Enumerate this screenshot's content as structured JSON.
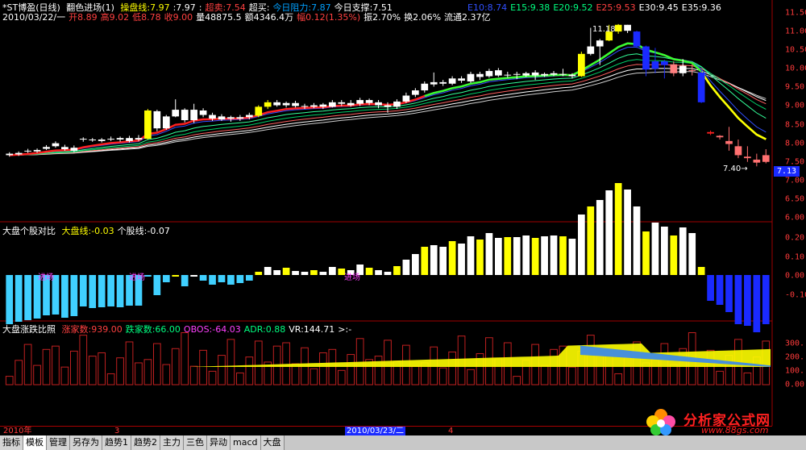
{
  "top_panel": {
    "title": "*ST博盈(日线)",
    "indicator": "翻色进场(1)",
    "items": [
      {
        "label": "操盘线:7.97",
        "color": "#ffff00"
      },
      {
        "label": ":7.97",
        "color": "#ffffff"
      },
      {
        "label": ":",
        "color": "#ffffff"
      },
      {
        "label": "超卖:7.54",
        "color": "#ff4040"
      },
      {
        "label": "超买:",
        "color": "#ffffff"
      },
      {
        "label": "今日阻力:7.87",
        "color": "#00a0ff"
      },
      {
        "label": "今日支撑:7.51",
        "color": "#ffffff"
      }
    ],
    "ma": [
      {
        "label": "E10:8.74",
        "color": "#3050ff"
      },
      {
        "label": "E15:9.38",
        "color": "#00ff80"
      },
      {
        "label": "E20:9.52",
        "color": "#00ff80"
      },
      {
        "label": "E25:9.53",
        "color": "#ff4040"
      },
      {
        "label": "E30:9.45",
        "color": "#ffffff"
      },
      {
        "label": "E35:9.36",
        "color": "#ffffff"
      }
    ],
    "line2": [
      {
        "label": "2010/03/22/一",
        "color": "#ffffff"
      },
      {
        "label": "开8.89",
        "color": "#ff4040"
      },
      {
        "label": "高9.02",
        "color": "#ff4040"
      },
      {
        "label": "低8.78",
        "color": "#ff4040"
      },
      {
        "label": "收9.00",
        "color": "#ff4040"
      },
      {
        "label": "量48875.5",
        "color": "#ffffff"
      },
      {
        "label": "额4346.4万",
        "color": "#ffffff"
      },
      {
        "label": "幅0.12(1.35%)",
        "color": "#ff4040"
      },
      {
        "label": "振2.70%",
        "color": "#ffffff"
      },
      {
        "label": "换2.06%",
        "color": "#ffffff"
      },
      {
        "label": "流通2.37亿",
        "color": "#ffffff"
      }
    ],
    "axis": [
      "11.50",
      "11.00",
      "10.50",
      "10.00",
      "9.50",
      "9.00",
      "8.50",
      "8.00",
      "7.50",
      "7.00",
      "6.50",
      "6.00"
    ],
    "price_tag": "7.13",
    "annot_high": "11.18",
    "annot_low": "7.40"
  },
  "mid_panel": {
    "title": "大盘个股对比",
    "items": [
      {
        "label": "大盘线:-0.03",
        "color": "#ffff00"
      },
      {
        "label": "个股线:-0.07",
        "color": "#ffffff"
      }
    ],
    "axis": [
      "0.20",
      "0.10",
      "0.00",
      "-0.10"
    ],
    "tag": "进场"
  },
  "bot_panel": {
    "title": "大盘涨跌比照",
    "items": [
      {
        "label": "涨家数:939.00",
        "color": "#ff4040"
      },
      {
        "label": "跌家数:66.00",
        "color": "#00ff80"
      },
      {
        "label": "OBOS:-64.03",
        "color": "#ff40ff"
      },
      {
        "label": "ADR:0.88",
        "color": "#00ff80"
      },
      {
        "label": "VR:144.71",
        "color": "#ffffff"
      },
      {
        "label": ">:-",
        "color": "#ffffff"
      }
    ],
    "axis": [
      "300.",
      "200.",
      "100.",
      "0.00"
    ]
  },
  "date_axis": {
    "left": "2010年",
    "m3": "3",
    "current": "2010/03/23/二",
    "m4": "4"
  },
  "tabs": [
    "指标",
    "模板",
    "管理",
    "另存为",
    "趋势1",
    "趋势2",
    "主力",
    "三色",
    "异动",
    "macd",
    "大盘"
  ],
  "active_tab": 1,
  "watermark": {
    "name": "分析家公式网",
    "url": "www.88gs.com"
  },
  "chart_data": {
    "type": "candlestick",
    "candles": [
      [
        7.72,
        7.68,
        7.76,
        7.64
      ],
      [
        7.7,
        7.74,
        7.78,
        7.66
      ],
      [
        7.8,
        7.78,
        7.85,
        7.74
      ],
      [
        7.78,
        7.82,
        7.86,
        7.74
      ],
      [
        7.85,
        7.9,
        7.95,
        7.82
      ],
      [
        8.0,
        7.92,
        8.05,
        7.88
      ],
      [
        7.9,
        7.84,
        7.96,
        7.8
      ],
      [
        7.8,
        7.88,
        7.94,
        7.76
      ],
      [
        8.1,
        8.12,
        8.16,
        8.04
      ],
      [
        8.1,
        8.08,
        8.14,
        8.04
      ],
      [
        8.06,
        8.1,
        8.14,
        8.02
      ],
      [
        8.1,
        8.12,
        8.18,
        8.06
      ],
      [
        8.14,
        8.1,
        8.18,
        8.04
      ],
      [
        8.06,
        8.14,
        8.2,
        8.02
      ],
      [
        8.1,
        8.14,
        8.22,
        8.06
      ],
      [
        8.12,
        8.88,
        8.92,
        8.1
      ],
      [
        8.86,
        8.4,
        8.9,
        8.32
      ],
      [
        8.4,
        8.72,
        8.76,
        8.36
      ],
      [
        8.72,
        8.9,
        9.18,
        8.7
      ],
      [
        8.9,
        8.62,
        8.94,
        8.56
      ],
      [
        8.62,
        8.9,
        9.06,
        8.54
      ],
      [
        8.88,
        8.76,
        8.94,
        8.7
      ],
      [
        8.76,
        8.66,
        8.82,
        8.6
      ],
      [
        8.64,
        8.72,
        8.78,
        8.6
      ],
      [
        8.7,
        8.66,
        8.74,
        8.58
      ],
      [
        8.66,
        8.7,
        8.76,
        8.6
      ],
      [
        8.7,
        8.76,
        8.82,
        8.64
      ],
      [
        8.74,
        8.98,
        9.02,
        8.7
      ],
      [
        8.98,
        9.1,
        9.16,
        8.92
      ],
      [
        9.1,
        9.02,
        9.16,
        8.98
      ],
      [
        9.02,
        9.08,
        9.12,
        8.96
      ],
      [
        9.08,
        9.0,
        9.14,
        8.96
      ],
      [
        9.0,
        8.98,
        9.06,
        8.92
      ],
      [
        8.98,
        9.02,
        9.08,
        8.94
      ],
      [
        9.04,
        8.98,
        9.08,
        8.92
      ],
      [
        8.98,
        9.1,
        9.16,
        8.96
      ],
      [
        9.1,
        9.06,
        9.16,
        9.0
      ],
      [
        9.08,
        9.02,
        9.16,
        8.98
      ],
      [
        9.06,
        9.16,
        9.22,
        9.0
      ],
      [
        9.16,
        9.08,
        9.2,
        9.02
      ],
      [
        9.1,
        9.02,
        9.16,
        8.94
      ],
      [
        9.02,
        8.98,
        9.1,
        8.82
      ],
      [
        8.98,
        9.12,
        9.18,
        8.92
      ],
      [
        9.12,
        9.28,
        9.36,
        9.08
      ],
      [
        9.3,
        9.42,
        9.48,
        9.24
      ],
      [
        9.42,
        9.6,
        9.66,
        9.36
      ],
      [
        9.58,
        9.64,
        9.9,
        9.52
      ],
      [
        9.64,
        9.6,
        9.7,
        9.54
      ],
      [
        9.6,
        9.74,
        9.8,
        9.56
      ],
      [
        9.74,
        9.68,
        9.8,
        9.62
      ],
      [
        9.66,
        9.86,
        9.92,
        9.62
      ],
      [
        9.86,
        9.78,
        9.92,
        9.7
      ],
      [
        9.8,
        9.94,
        10.0,
        9.76
      ],
      [
        9.96,
        9.82,
        10.02,
        9.78
      ],
      [
        9.82,
        9.84,
        9.92,
        9.76
      ],
      [
        9.86,
        9.84,
        9.92,
        9.72
      ],
      [
        9.82,
        9.88,
        9.92,
        9.78
      ],
      [
        9.9,
        9.82,
        9.96,
        9.7
      ],
      [
        9.82,
        9.86,
        9.9,
        9.78
      ],
      [
        9.84,
        9.88,
        9.94,
        9.8
      ],
      [
        9.86,
        9.86,
        10.0,
        9.8
      ],
      [
        9.84,
        9.8,
        9.88,
        9.74
      ],
      [
        9.8,
        10.4,
        10.46,
        9.78
      ],
      [
        10.4,
        10.6,
        11.1,
        10.36
      ],
      [
        10.6,
        10.76,
        10.8,
        10.1
      ],
      [
        10.76,
        11.0,
        11.18,
        10.74
      ],
      [
        11.0,
        11.18,
        11.2,
        10.94
      ],
      [
        11.18,
        11.02,
        11.18,
        10.96
      ],
      [
        11.0,
        10.6,
        11.02,
        10.56
      ],
      [
        10.6,
        9.98,
        10.62,
        9.8
      ],
      [
        10.0,
        10.2,
        10.56,
        9.88
      ],
      [
        10.2,
        10.1,
        10.24,
        9.74
      ],
      [
        10.12,
        9.88,
        10.2,
        9.8
      ],
      [
        9.88,
        10.08,
        10.26,
        9.8
      ],
      [
        9.96,
        9.94,
        10.12,
        9.82
      ],
      [
        9.9,
        9.1,
        9.96,
        9.08
      ],
      [
        8.3,
        8.26,
        8.34,
        8.22
      ],
      [
        8.2,
        8.16,
        8.22,
        8.1
      ],
      [
        8.06,
        7.98,
        8.44,
        7.8
      ],
      [
        7.92,
        7.68,
        8.1,
        7.6
      ],
      [
        7.6,
        7.64,
        7.92,
        7.5
      ],
      [
        7.56,
        7.48,
        7.72,
        7.38
      ],
      [
        7.5,
        7.68,
        7.84,
        7.46
      ]
    ]
  }
}
